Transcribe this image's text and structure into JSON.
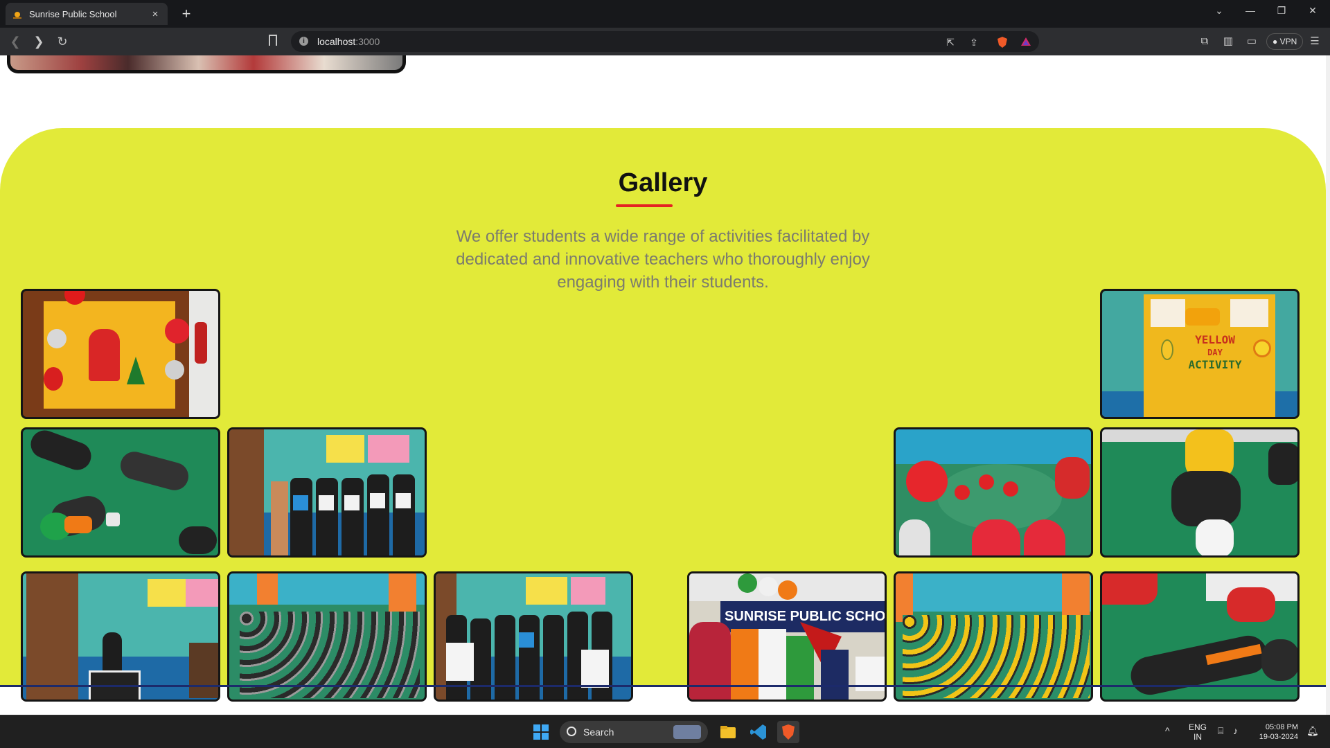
{
  "browser": {
    "tab_title": "Sunrise Public School",
    "tab_close": "×",
    "new_tab": "+",
    "url_host": "localhost",
    "url_port": ":3000",
    "vpn_label": "VPN",
    "icons": [
      "back-icon",
      "forward-icon",
      "reload-icon",
      "bookmark-icon",
      "info-icon",
      "open-external-icon",
      "share-icon",
      "brave-shield-icon",
      "brave-rewards-icon",
      "extensions-icon",
      "sidebar-icon",
      "wallet-icon",
      "menu-icon"
    ]
  },
  "gallery": {
    "title": "Gallery",
    "tagline": "We offer students a wide range of activities facilitated by dedicated and innovative teachers who thoroughly enjoy engaging with their students.",
    "accent_color": "#e52322",
    "background_color": "#e2ea39",
    "photo_text": {
      "banner": "SUNRISE PUBLIC SCHOOL",
      "yellow_day_1": "YELLOW",
      "yellow_day_2": "DAY",
      "yellow_day_3": "ACTIVITY"
    }
  },
  "taskbar": {
    "search_label": "Search",
    "language": "ENG",
    "region": "IN",
    "time": "05:08 PM",
    "date": "19-03-2024"
  }
}
